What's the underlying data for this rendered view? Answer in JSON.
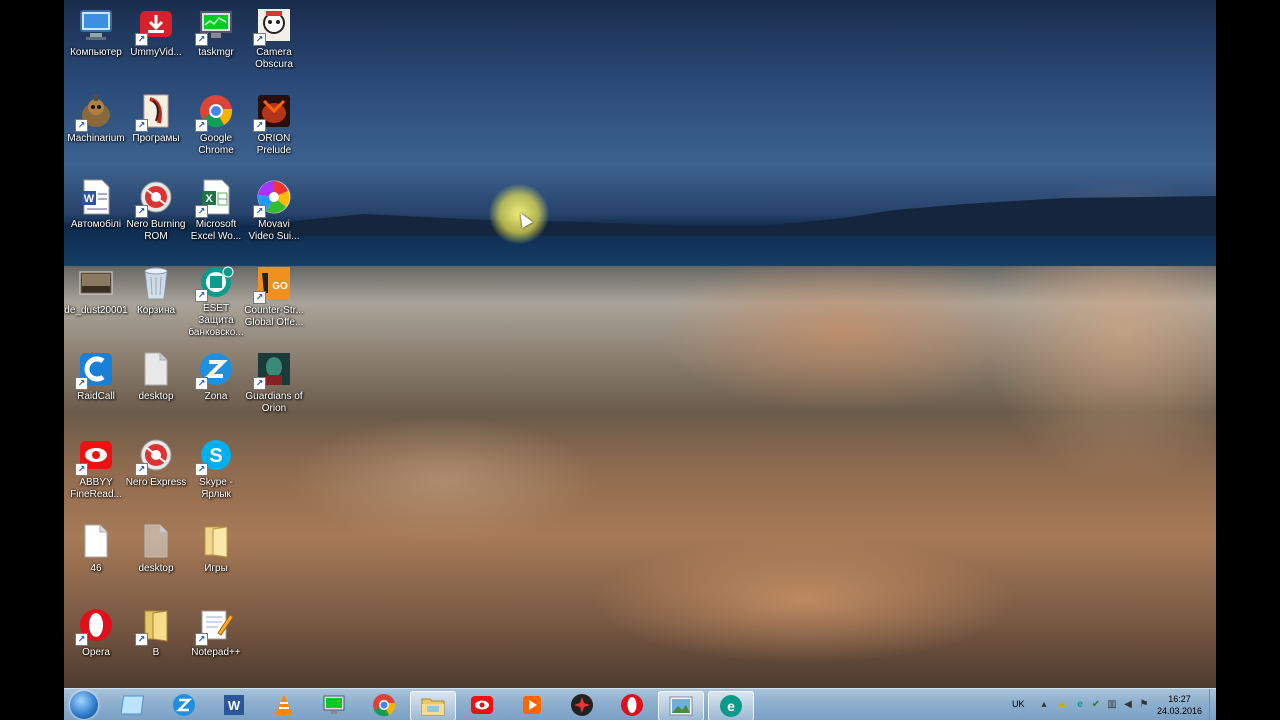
{
  "desktop": {
    "icons": [
      {
        "label": "Компьютер",
        "icon": "computer-icon"
      },
      {
        "label": "UmmyVid...",
        "icon": "download-icon"
      },
      {
        "label": "taskmgr",
        "icon": "monitor-icon"
      },
      {
        "label": "Camera\nObscura",
        "icon": "camera-obscura-icon"
      },
      {
        "label": "Machinarium",
        "icon": "machinarium-icon"
      },
      {
        "label": "Програмы",
        "icon": "programs-icon"
      },
      {
        "label": "Google\nChrome",
        "icon": "chrome-icon"
      },
      {
        "label": "ORION\nPrelude",
        "icon": "orion-icon"
      },
      {
        "label": "Автомобілі",
        "icon": "word-doc-icon"
      },
      {
        "label": "Nero Burning\nROM",
        "icon": "nero-icon"
      },
      {
        "label": "Microsoft\nExcel Wo...",
        "icon": "excel-icon"
      },
      {
        "label": "Movavi\nVideo Sui...",
        "icon": "movavi-icon"
      },
      {
        "label": "de_dust20001",
        "icon": "image-file-icon"
      },
      {
        "label": "Корзина",
        "icon": "recycle-bin-icon"
      },
      {
        "label": "ESET Защита\nбанковско...",
        "icon": "eset-icon"
      },
      {
        "label": "Counter-Str...\nGlobal Offe...",
        "icon": "csgo-icon"
      },
      {
        "label": "RaidCall",
        "icon": "raidcall-icon"
      },
      {
        "label": "desktop",
        "icon": "file-icon"
      },
      {
        "label": "Zona",
        "icon": "zona-icon"
      },
      {
        "label": "Guardians of\nOrion",
        "icon": "guardians-icon"
      },
      {
        "label": "ABBYY\nFineRead...",
        "icon": "abbyy-icon"
      },
      {
        "label": "Nero Express",
        "icon": "nero-icon"
      },
      {
        "label": "Skype -\nЯрлык",
        "icon": "skype-icon"
      },
      {
        "label": "46",
        "icon": "file-icon"
      },
      {
        "label": "desktop",
        "icon": "file-icon"
      },
      {
        "label": "Игры",
        "icon": "folder-icon"
      },
      {
        "label": "Opera",
        "icon": "opera-icon"
      },
      {
        "label": "В",
        "icon": "folder-icon"
      },
      {
        "label": "Notepad++",
        "icon": "notepad-icon"
      }
    ]
  },
  "taskbar": {
    "buttons": [
      {
        "name": "aero-icon"
      },
      {
        "name": "zona-icon"
      },
      {
        "name": "word-icon"
      },
      {
        "name": "vlc-icon"
      },
      {
        "name": "monitor-icon"
      },
      {
        "name": "chrome-icon"
      },
      {
        "name": "explorer-icon"
      },
      {
        "name": "abbyy-icon"
      },
      {
        "name": "media-player-icon"
      },
      {
        "name": "gamecenter-icon"
      },
      {
        "name": "opera-icon"
      },
      {
        "name": "photo-viewer-icon"
      },
      {
        "name": "eset-icon"
      }
    ],
    "tray": {
      "language": "UK",
      "time": "16:27",
      "date": "24.03.2016"
    }
  }
}
